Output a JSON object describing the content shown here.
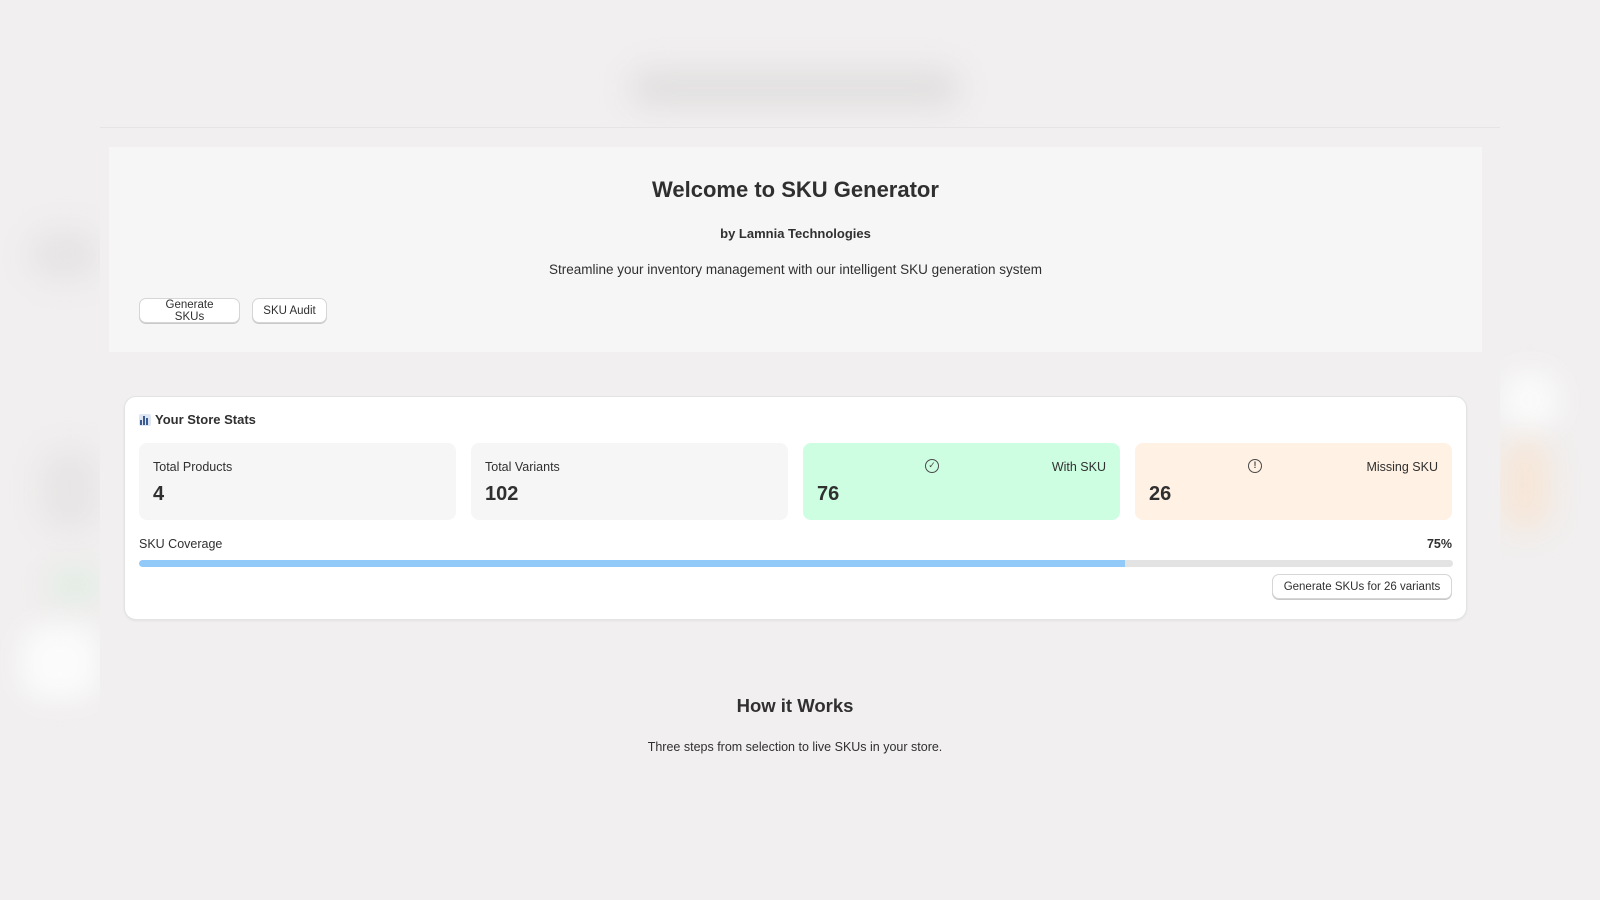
{
  "hero": {
    "title": "Welcome to SKU Generator",
    "byline": "by Lamnia Technologies",
    "description": "Streamline your inventory management with our intelligent SKU generation system",
    "buttons": {
      "generate": "Generate SKUs",
      "audit": "SKU Audit"
    }
  },
  "stats": {
    "title": "Your Store Stats",
    "icon": "bar-chart-icon",
    "tiles": [
      {
        "label": "Total Products",
        "value": "4"
      },
      {
        "label": "Total Variants",
        "value": "102"
      },
      {
        "label": "With SKU",
        "value": "76",
        "icon": "check-circle-icon",
        "color": "#cdfee1"
      },
      {
        "label": "Missing SKU",
        "value": "26",
        "icon": "alert-circle-icon",
        "color": "#fff1e3"
      }
    ],
    "coverage_label": "SKU Coverage",
    "coverage_text": "75%",
    "coverage_fraction": 0.75,
    "progress_color": "#91caf9",
    "generate_button": "Generate SKUs for 26 variants"
  },
  "how": {
    "title": "How it Works",
    "description": "Three steps from selection to live SKUs in your store."
  }
}
